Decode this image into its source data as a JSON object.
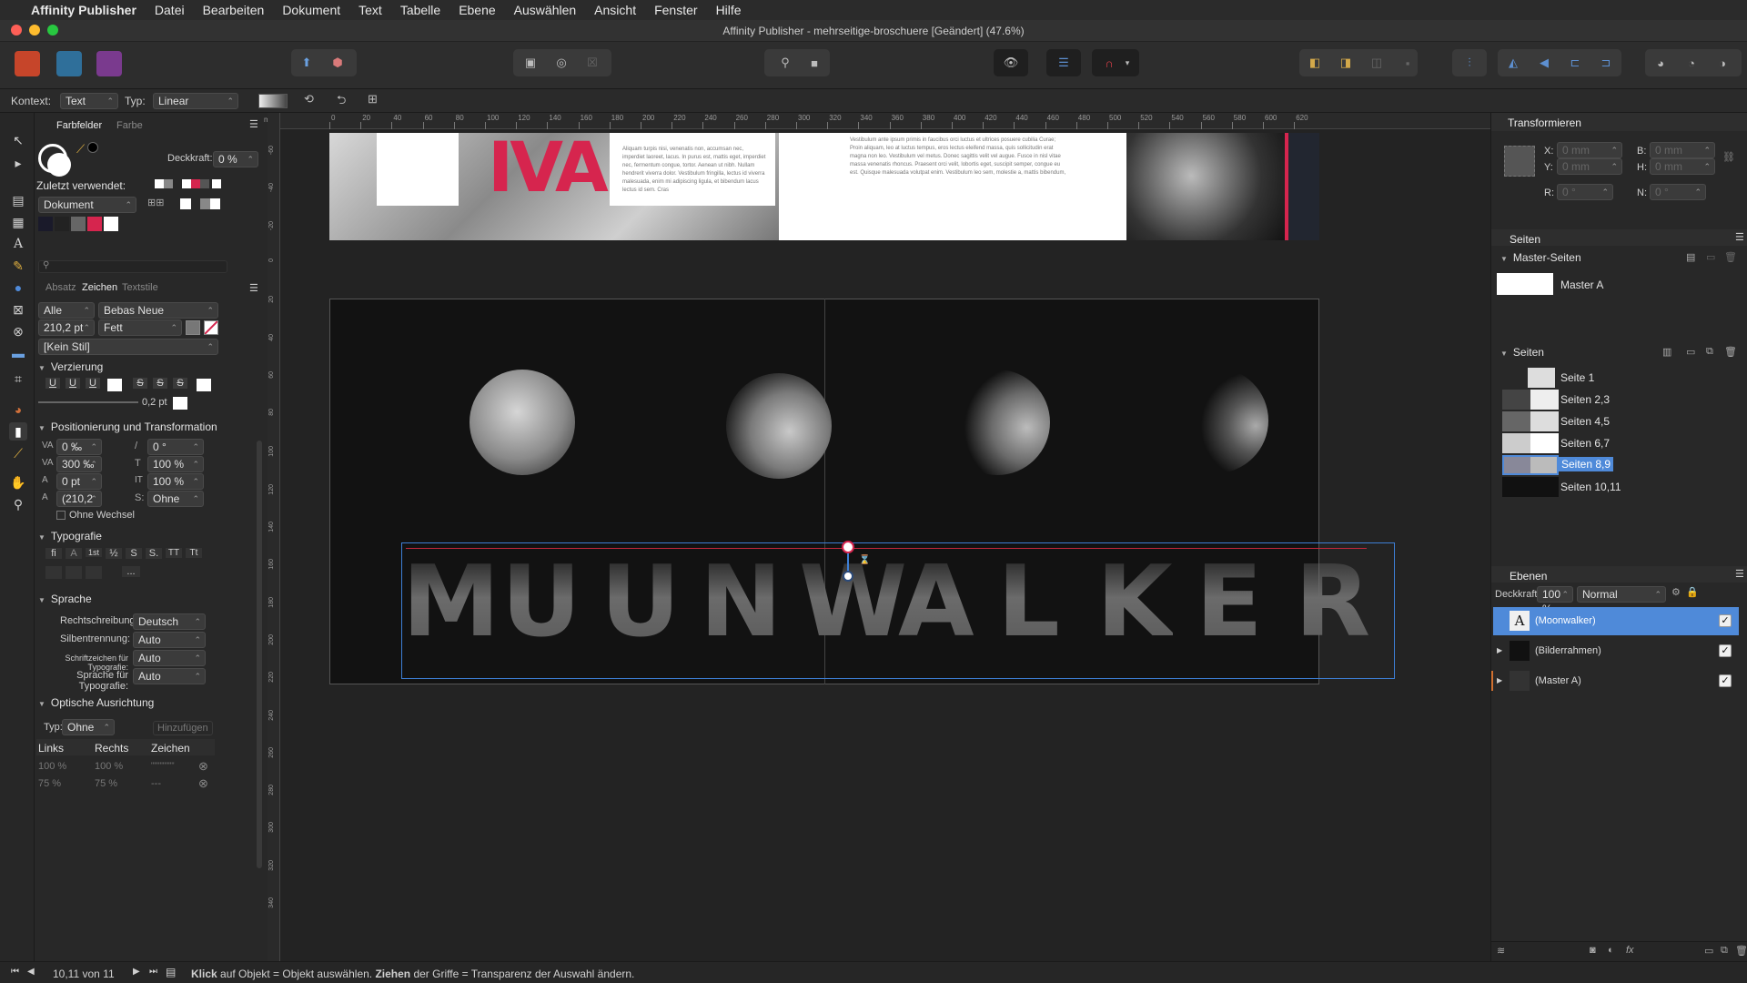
{
  "menubar": {
    "apple": "",
    "app": "Affinity Publisher",
    "items": [
      "Datei",
      "Bearbeiten",
      "Dokument",
      "Text",
      "Tabelle",
      "Ebene",
      "Auswählen",
      "Ansicht",
      "Fenster",
      "Hilfe"
    ]
  },
  "window": {
    "title": "Affinity Publisher - mehrseitige-broschuere [Geändert] (47.6%)"
  },
  "context": {
    "kontext_label": "Kontext:",
    "kontext_value": "Text",
    "typ_label": "Typ:",
    "typ_value": "Linear"
  },
  "left_panel": {
    "tabs": [
      "Farbfelder",
      "Farbe"
    ],
    "opacity_label": "Deckkraft:",
    "opacity_value": "0 %",
    "recent_label": "Zuletzt verwendet:",
    "palette_value": "Dokument",
    "char_tabs": [
      "Absatz",
      "Zeichen",
      "Textstile"
    ],
    "font_scope": "Alle Schr...",
    "font_family": "Bebas Neue",
    "font_size": "210,2 pt",
    "font_weight": "Fett",
    "style": "[Kein Stil]",
    "decoration_title": "Verzierung",
    "decoration_buttons": [
      "U",
      "U",
      "U",
      "S",
      "S",
      "S"
    ],
    "stroke_width": "0,2 pt",
    "position_title": "Positionierung und Transformation",
    "kerning": "0 ‰",
    "shear": "0 °",
    "tracking": "300 ‰",
    "v_scale": "100 %",
    "baseline": "0 pt",
    "h_scale": "100 %",
    "leading": "(210,2",
    "s_label": "S:",
    "s_value": "Ohne",
    "no_break": "Ohne Wechsel",
    "typography_title": "Typografie",
    "typo_buttons": [
      "fi",
      "A",
      "1st",
      "½",
      "S",
      "S.",
      "TT",
      "Tt"
    ],
    "more": "...",
    "language_title": "Sprache",
    "spell_label": "Rechtschreibung:",
    "spell_value": "Deutsch",
    "hyph_label": "Silbentrennung:",
    "hyph_value": "Auto",
    "glyph_label": "Schriftzeichen für Typografie:",
    "glyph_value": "Auto",
    "typo_lang_label": "Sprache für Typografie:",
    "typo_lang_value": "Auto",
    "optical_title": "Optische Ausrichtung",
    "optical_type_label": "Typ:",
    "optical_type_value": "Ohne",
    "add_button": "Hinzufügen",
    "table_headers": [
      "Links",
      "Rechts",
      "Zeichen"
    ],
    "table_rows": [
      [
        "100 %",
        "100 %",
        "\"\"\"\"\"\"\"\""
      ],
      [
        "75 %",
        "75 %",
        "---"
      ]
    ]
  },
  "ruler_top": [
    "0",
    "20",
    "40",
    "60",
    "80",
    "100",
    "120",
    "140",
    "160",
    "180",
    "200",
    "220",
    "240",
    "260",
    "280",
    "300",
    "320",
    "340",
    "360",
    "380",
    "400",
    "420",
    "440",
    "460",
    "480",
    "500",
    "520",
    "540",
    "560",
    "580",
    "600",
    "620"
  ],
  "ruler_left": [
    "-60",
    "-40",
    "-20",
    "0",
    "20",
    "40",
    "60",
    "80",
    "100",
    "120",
    "140",
    "160",
    "180",
    "200",
    "220",
    "240",
    "260",
    "280",
    "300",
    "320",
    "340"
  ],
  "ruler_unit": "mm",
  "canvas": {
    "spread_title_letters": "IVA",
    "lorem_left": "Aliquam turpis nisi, venenatis non, accumsan nec, imperdiet laoreet, lacus. In purus est, mattis eget, imperdiet nec, fermentum congue, tortor. Aenean ut nibh. Nullam hendrerit viverra dolor. Vestibulum fringilla, lectus id viverra malesuada, enim mi adipiscing ligula, et bibendum lacus lectus id sem. Cras",
    "lorem_right": "Vestibulum ante ipsum primis in faucibus orci luctus et ultrices posuere cubilia Curae; Proin aliquam, leo at luctus tempus, eros lectus eleifend massa, quis sollicitudin erat magna non leo. Vestibulum vel metus. Donec sagittis velit vel augue. Fusce in nisl vitae massa venenatis rhoncus. Praesent orci velit, lobortis eget, suscipit semper, congue eu est. Quisque malesuada volutpat enim. Vestibulum leo sem, molestie a, mattis bibendum,",
    "headline": [
      "M",
      "U",
      "U",
      "N",
      "W",
      "A",
      "L",
      "K",
      "E",
      "R"
    ]
  },
  "right_panel": {
    "transform_title": "Transformieren",
    "x_label": "X:",
    "x_value": "0 mm",
    "y_label": "Y:",
    "y_value": "0 mm",
    "b_label": "B:",
    "b_value": "0 mm",
    "h_label": "H:",
    "h_value": "0 mm",
    "r_label": "R:",
    "r_value": "0 °",
    "n_label": "N:",
    "n_value": "0 °",
    "pages_title": "Seiten",
    "master_title": "Master-Seiten",
    "master_item": "Master A",
    "pages_sub": "Seiten",
    "pages": [
      "Seite 1",
      "Seiten 2,3",
      "Seiten 4,5",
      "Seiten 6,7",
      "Seiten 8,9",
      "Seiten 10,11"
    ],
    "layers_title": "Ebenen",
    "layers_opacity_label": "Deckkraft:",
    "layers_opacity_value": "100 %",
    "blend_mode": "Normal",
    "layers": [
      "(Moonwalker)",
      "(Bilderrahmen)",
      "(Master A)"
    ]
  },
  "status": {
    "page_indicator": "10,11 von 11",
    "hint_bold1": "Klick",
    "hint1": " auf Objekt = Objekt auswählen. ",
    "hint_bold2": "Ziehen",
    "hint2": " der Griffe = Transparenz der Auswahl ändern."
  },
  "colors": {
    "accent": "#4f8ad9",
    "magenta": "#d6254e",
    "selection": "#3d7fd6"
  }
}
